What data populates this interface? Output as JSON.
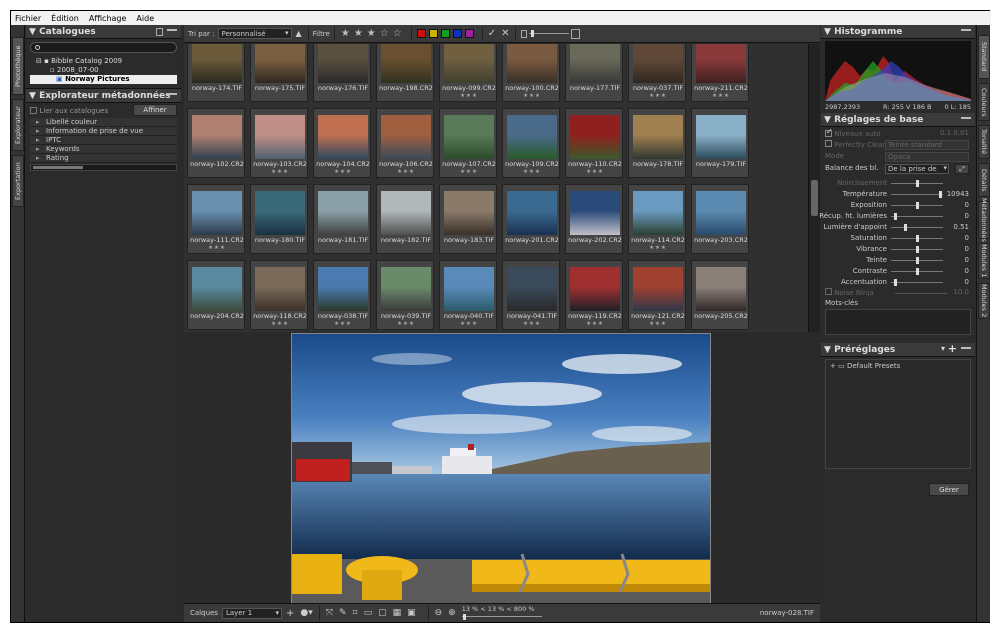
{
  "menu": [
    "Fichier",
    "Édition",
    "Affichage",
    "Aide"
  ],
  "left_tabs": [
    "Photothèque",
    "Explorateur",
    "Exportation"
  ],
  "right_tabs": [
    "Standard",
    "Couleurs",
    "Tonalité",
    "Détails",
    "Métadonnées",
    "Modules 1",
    "Modules 2"
  ],
  "catalogues": {
    "title": "Catalogues",
    "tree": [
      "Bibble Catalog 2009",
      "2008_07-00",
      "Norway Pictures"
    ]
  },
  "meta_explorer": {
    "title": "Explorateur métadonnées",
    "link_label": "Lier aux catalogues",
    "refine_button": "Affiner",
    "items": [
      "Libellé couleur",
      "Information de prise de vue",
      "IPTC",
      "Keywords",
      "Rating"
    ]
  },
  "toolbar": {
    "sort_label": "Tri par :",
    "sort_value": "Personnalisé",
    "filter_label": "Filtre",
    "colors": [
      "#d01010",
      "#c8b400",
      "#10a020",
      "#1030c0",
      "#a020a0"
    ]
  },
  "thumbnails": [
    {
      "name": "norway-174.TIF",
      "stars": "",
      "c1": "#6b5a3a",
      "c2": "#2a2a20"
    },
    {
      "name": "norway-175.TIF",
      "stars": "",
      "c1": "#7a6040",
      "c2": "#302820"
    },
    {
      "name": "norway-176.TIF",
      "stars": "",
      "c1": "#5a5040",
      "c2": "#2a2a2a"
    },
    {
      "name": "norway-198.CR2",
      "stars": "",
      "c1": "#6a5030",
      "c2": "#303020"
    },
    {
      "name": "norway-099.CR2",
      "stars": "★★★",
      "c1": "#706040",
      "c2": "#404030"
    },
    {
      "name": "norway-100.CR2",
      "stars": "★★★",
      "c1": "#7a5a40",
      "c2": "#383028"
    },
    {
      "name": "norway-177.TIF",
      "stars": "",
      "c1": "#6a6a5a",
      "c2": "#383838"
    },
    {
      "name": "norway-037.TIF",
      "stars": "★★★",
      "c1": "#604838",
      "c2": "#302820"
    },
    {
      "name": "norway-211.CR2",
      "stars": "★★★",
      "c1": "#8a3a3a",
      "c2": "#402020"
    },
    {
      "name": "norway-102.CR2",
      "stars": "",
      "c1": "#b08070",
      "c2": "#304050"
    },
    {
      "name": "norway-103.CR2",
      "stars": "★★★",
      "c1": "#c09088",
      "c2": "#506070"
    },
    {
      "name": "norway-104.CR2",
      "stars": "★★★",
      "c1": "#c07050",
      "c2": "#304860"
    },
    {
      "name": "norway-106.CR2",
      "stars": "★★★",
      "c1": "#a06040",
      "c2": "#3a4a5a"
    },
    {
      "name": "norway-107.CR2",
      "stars": "★★★",
      "c1": "#5a7a5a",
      "c2": "#2a4a2a"
    },
    {
      "name": "norway-109.CR2",
      "stars": "★★★",
      "c1": "#4a6a8a",
      "c2": "#2a5a2a"
    },
    {
      "name": "norway-110.CR2",
      "stars": "★★★",
      "c1": "#902020",
      "c2": "#3a5a2a"
    },
    {
      "name": "norway-178.TIF",
      "stars": "",
      "c1": "#a08050",
      "c2": "#303830"
    },
    {
      "name": "norway-179.TIF",
      "stars": "",
      "c1": "#8ab0c8",
      "c2": "#2a4a5a"
    },
    {
      "name": "norway-111.CR2",
      "stars": "★★★",
      "c1": "#6a90b0",
      "c2": "#2a3a4a"
    },
    {
      "name": "norway-180.TIF",
      "stars": "",
      "c1": "#3a6a7a",
      "c2": "#1a3040"
    },
    {
      "name": "norway-181.TIF",
      "stars": "",
      "c1": "#8aa0a8",
      "c2": "#404040"
    },
    {
      "name": "norway-182.TIF",
      "stars": "",
      "c1": "#b0b8b8",
      "c2": "#505050"
    },
    {
      "name": "norway-183.TIF",
      "stars": "",
      "c1": "#8a7a6a",
      "c2": "#3a3028"
    },
    {
      "name": "norway-201.CR2",
      "stars": "",
      "c1": "#3a6a90",
      "c2": "#1a3050"
    },
    {
      "name": "norway-202.CR2",
      "stars": "",
      "c1": "#2a4a7a",
      "c2": "#c0c0c8"
    },
    {
      "name": "norway-114.CR2",
      "stars": "★★★",
      "c1": "#6a9ac0",
      "c2": "#2a4030"
    },
    {
      "name": "norway-203.CR2",
      "stars": "",
      "c1": "#5a8ab0",
      "c2": "#2a4a6a"
    },
    {
      "name": "norway-204.CR2",
      "stars": "",
      "c1": "#5a8aa0",
      "c2": "#3a4a3a"
    },
    {
      "name": "norway-118.CR2",
      "stars": "★★★",
      "c1": "#7a6a5a",
      "c2": "#3a3028"
    },
    {
      "name": "norway-038.TIF",
      "stars": "★★★",
      "c1": "#4a7ab0",
      "c2": "#2a3a2a"
    },
    {
      "name": "norway-039.TIF",
      "stars": "★★★",
      "c1": "#6a8a6a",
      "c2": "#3a3a3a"
    },
    {
      "name": "norway-040.TIF",
      "stars": "★★★",
      "c1": "#5a8ab8",
      "c2": "#2a5a6a"
    },
    {
      "name": "norway-041.TIF",
      "stars": "★★★",
      "c1": "#3a4a5a",
      "c2": "#2a2a2a"
    },
    {
      "name": "norway-119.CR2",
      "stars": "★★★",
      "c1": "#a03030",
      "c2": "#202028"
    },
    {
      "name": "norway-121.CR2",
      "stars": "★★★",
      "c1": "#a04030",
      "c2": "#303848"
    },
    {
      "name": "norway-205.CR2",
      "stars": "",
      "c1": "#8a8078",
      "c2": "#302828"
    }
  ],
  "bottom": {
    "layers_label": "Calques",
    "layer_value": "Layer 1",
    "zoom_text": "13 % < 13 % < 800 %",
    "filename": "norway-028.TIF"
  },
  "histogram": {
    "title": "Histogramme",
    "coords": "2987,2393",
    "rgb": "R: 255 V 186 B",
    "lum": "0   L: 185"
  },
  "basic": {
    "title": "Réglages de base",
    "auto_level": "Niveaux auto",
    "auto_vals": "0.1    0.01",
    "perfect_clear": "Perfectly Clear",
    "perfect_clear_value": "Teinte standard",
    "mode_label": "Mode",
    "mode_value": "Opaca",
    "wb_label": "Balance des bl.",
    "wb_value": "De la prise de",
    "sliders": [
      {
        "label": "Noircissement",
        "value": "",
        "level": 0.5,
        "disabled": true
      },
      {
        "label": "Température",
        "value": "10943",
        "level": 0.95,
        "disabled": false
      },
      {
        "label": "Exposition",
        "value": "0",
        "level": 0.5,
        "disabled": false
      },
      {
        "label": "Récup. ht. lumières",
        "value": "0",
        "level": 0.05,
        "disabled": false
      },
      {
        "label": "Lumière d'appoint",
        "value": "0.51",
        "level": 0.25,
        "disabled": false
      },
      {
        "label": "Saturation",
        "value": "0",
        "level": 0.5,
        "disabled": false
      },
      {
        "label": "Vibrance",
        "value": "0",
        "level": 0.5,
        "disabled": false
      },
      {
        "label": "Teinte",
        "value": "0",
        "level": 0.5,
        "disabled": false
      },
      {
        "label": "Contraste",
        "value": "0",
        "level": 0.5,
        "disabled": false
      },
      {
        "label": "Accentuation",
        "value": "0",
        "level": 0.05,
        "disabled": false
      }
    ],
    "noise_label": "Noise Ninja",
    "noise_value": "10.0",
    "keywords_label": "Mots-clés"
  },
  "presets": {
    "title": "Préréglages",
    "items": [
      "Default Presets"
    ],
    "manage_button": "Gérer"
  }
}
